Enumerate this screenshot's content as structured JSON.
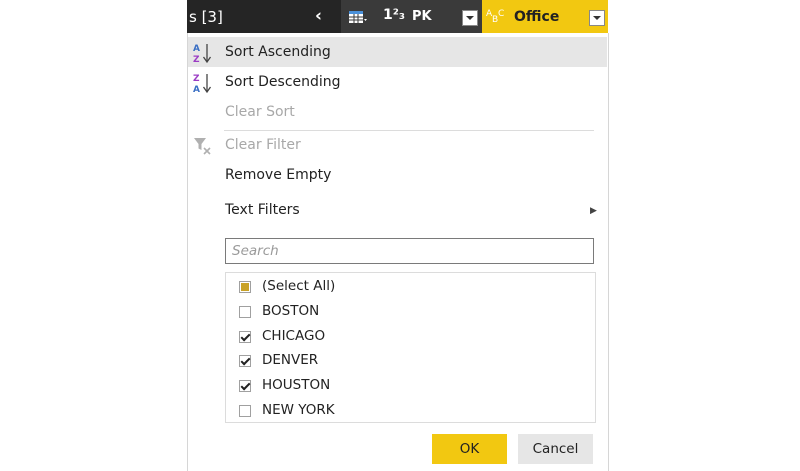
{
  "header": {
    "query_label": "s [3]",
    "collapse_glyph": "‹",
    "column1": {
      "type_glyph": "1²₃",
      "name": "PK"
    },
    "column2": {
      "type_glyph": "ABC",
      "name": "Office"
    }
  },
  "menu": {
    "sort_ascending": "Sort Ascending",
    "sort_descending": "Sort Descending",
    "clear_sort": "Clear Sort",
    "clear_filter": "Clear Filter",
    "remove_empty": "Remove Empty",
    "text_filters": "Text Filters"
  },
  "search": {
    "placeholder": "Search"
  },
  "list": {
    "items": [
      {
        "label": "(Select All)",
        "state": "partial"
      },
      {
        "label": "BOSTON",
        "state": "unchecked"
      },
      {
        "label": "CHICAGO",
        "state": "checked"
      },
      {
        "label": "DENVER",
        "state": "checked"
      },
      {
        "label": "HOUSTON",
        "state": "checked"
      },
      {
        "label": "NEW YORK",
        "state": "unchecked"
      }
    ]
  },
  "buttons": {
    "ok": "OK",
    "cancel": "Cancel"
  },
  "colors": {
    "accent": "#f2c811",
    "header_dark": "#252525",
    "highlight": "#e6e6e6"
  }
}
